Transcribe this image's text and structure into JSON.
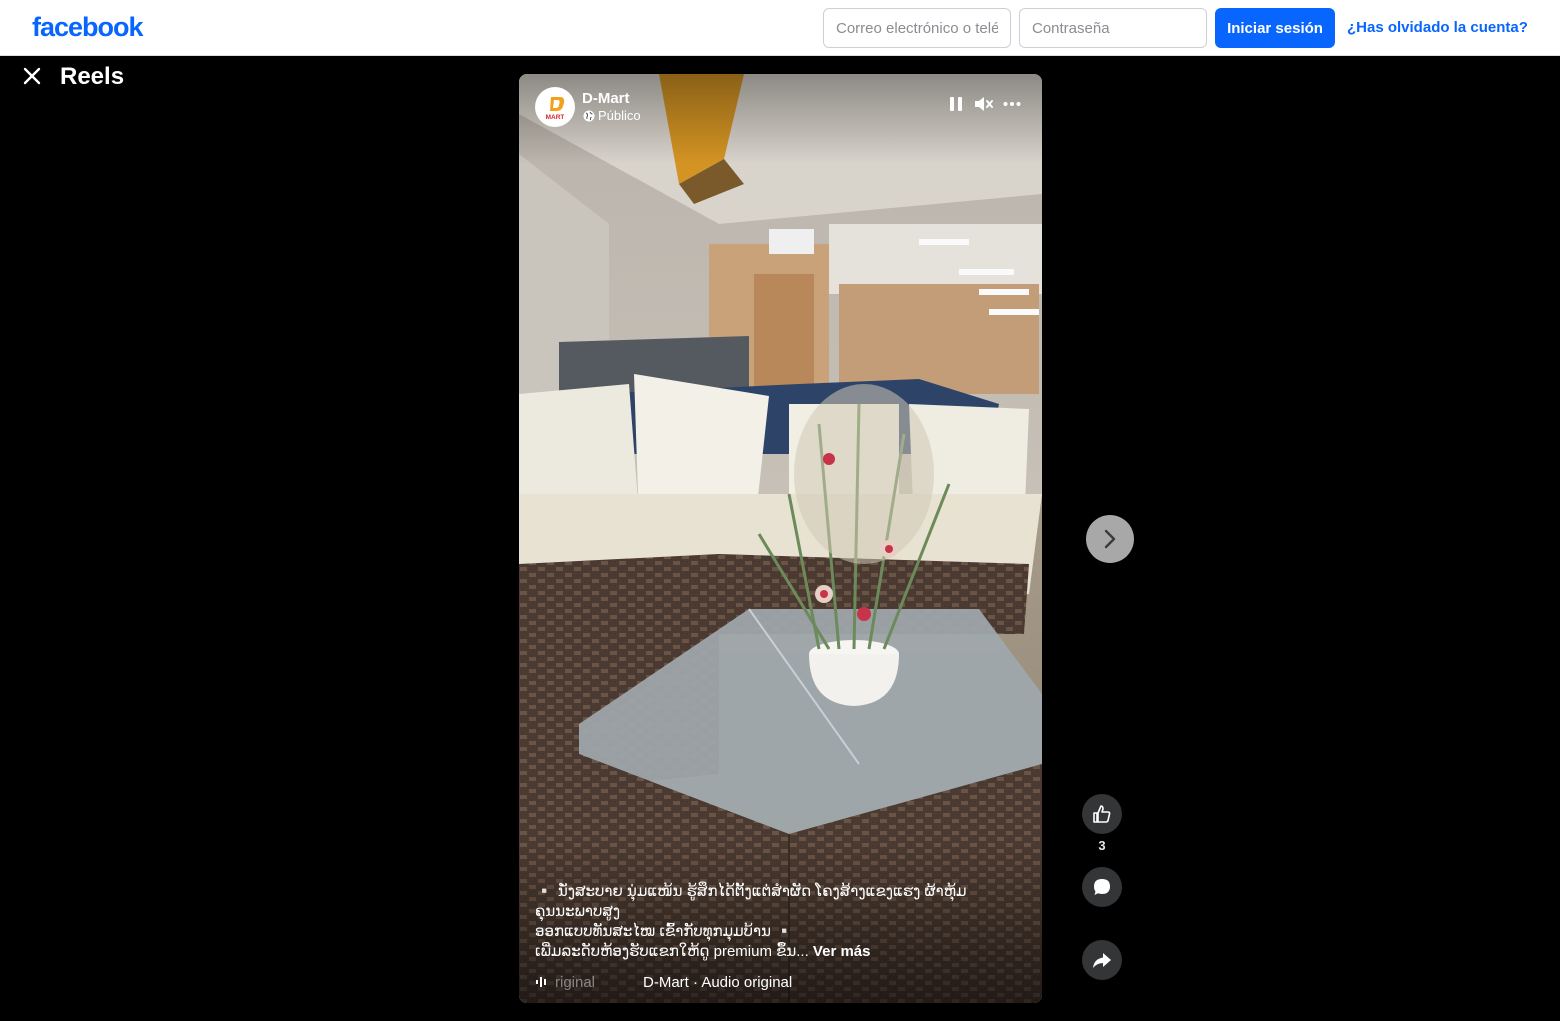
{
  "header": {
    "logo": "facebook",
    "email_placeholder": "Correo electrónico o teléfono",
    "password_placeholder": "Contraseña",
    "login_label": "Iniciar sesión",
    "forgot_label": "¿Has olvidado la cuenta?"
  },
  "page": {
    "title": "Reels"
  },
  "reel": {
    "author": "D-Mart",
    "avatar_text": "MART",
    "privacy": "Público",
    "caption_line1": "▫️ ນັ່ງສະບາຍ ນຸ່ມແໜ້ນ ຮູ້ສຶກໄດ້ຕັ້ງແຕ່ສໍາຜັດ ໂຄງສ້າງແຂງແຮງ ຜ້າຫຸ້ມຄຸນນະພາບສູງ",
    "caption_line2": "ອອກແບບທັນສະໄໝ ເຂົ້າກັບທຸກມຸມບ້ານ ▫️",
    "caption_line3": "ເພີ່ມລະດັບຫ້ອງຮັບແຂກໃຫ້ດູ premium ຂຶ້ນ...",
    "see_more": "Ver más",
    "audio_faded": "riginal",
    "audio": "D-Mart · Audio original"
  },
  "actions": {
    "like_count": "3"
  },
  "icons": {
    "close": "close-icon",
    "pause": "pause-icon",
    "mute": "muted-speaker-icon",
    "more": "more-dots-icon",
    "globe": "globe-icon",
    "next": "chevron-right-icon",
    "like": "thumbs-up-icon",
    "comment": "comment-bubble-icon",
    "share": "share-arrow-icon",
    "audio": "audio-wave-icon"
  },
  "colors": {
    "brand": "#0866ff",
    "background": "#000000",
    "action_button": "#333536"
  }
}
